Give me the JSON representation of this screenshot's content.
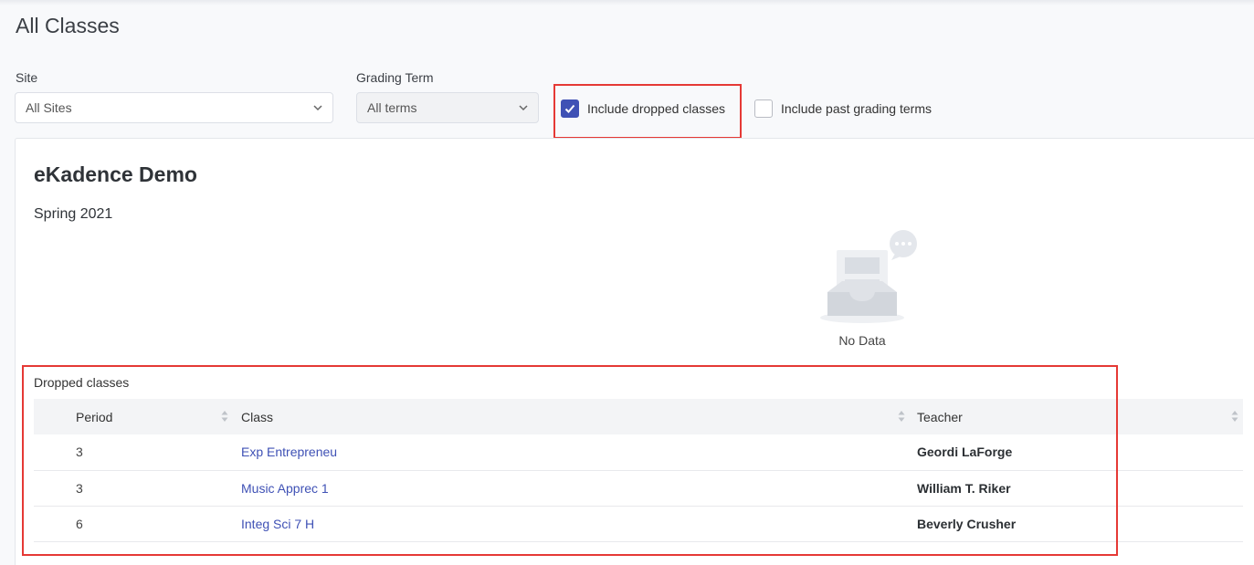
{
  "page": {
    "title": "All Classes"
  },
  "filters": {
    "site": {
      "label": "Site",
      "value": "All Sites"
    },
    "grading_term": {
      "label": "Grading Term",
      "value": "All terms"
    },
    "include_dropped": {
      "label": "Include dropped classes",
      "checked": true
    },
    "include_past": {
      "label": "Include past grading terms",
      "checked": false
    }
  },
  "card": {
    "site_name": "eKadence Demo",
    "term": "Spring 2021",
    "empty_text": "No Data"
  },
  "dropped": {
    "title": "Dropped classes",
    "columns": {
      "period": "Period",
      "class": "Class",
      "teacher": "Teacher"
    },
    "rows": [
      {
        "period": "3",
        "class": "Exp Entrepreneu",
        "teacher": "Geordi LaForge"
      },
      {
        "period": "3",
        "class": "Music Apprec 1",
        "teacher": "William T. Riker"
      },
      {
        "period": "6",
        "class": "Integ Sci 7 H",
        "teacher": "Beverly Crusher"
      }
    ]
  },
  "colors": {
    "accent": "#3f51b5",
    "highlight": "#e53935"
  }
}
